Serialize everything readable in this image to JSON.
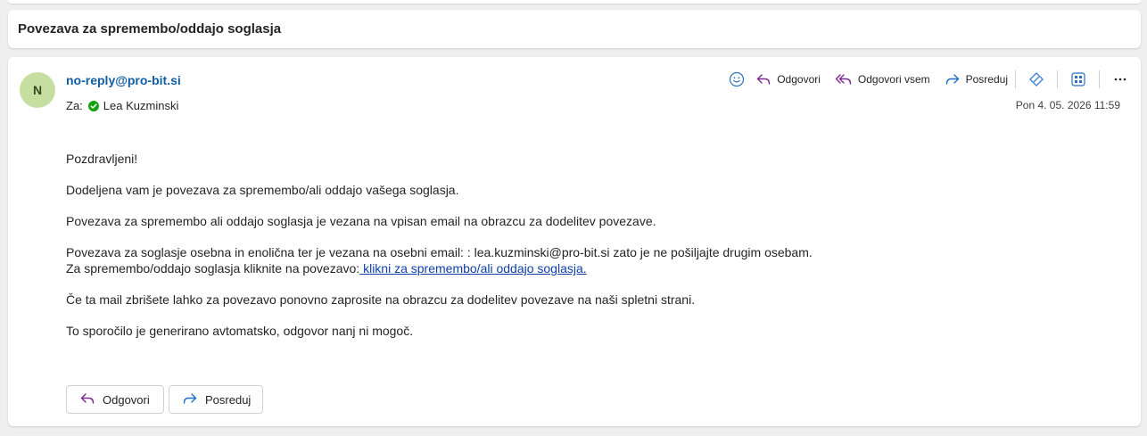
{
  "subject": "Povezava za spremembo/oddajo soglasja",
  "message": {
    "avatar_initial": "N",
    "sender": "no-reply@pro-bit.si",
    "to_label": "Za:",
    "recipient": "Lea Kuzminski",
    "timestamp": "Pon 4. 05. 2026 11:59",
    "toolbar": {
      "reply": "Odgovori",
      "reply_all": "Odgovori vsem",
      "forward": "Posreduj"
    },
    "body": {
      "greeting": "Pozdravljeni!",
      "p1": "Dodeljena vam je povezava za spremembo/ali oddajo vašega soglasja.",
      "p2": "Povezava za spremembo ali oddajo soglasja je vezana na vpisan email na obrazcu za dodelitev povezave.",
      "p3_line1": "Povezava za soglasje osebna in enolična ter je vezana na osebni email: : lea.kuzminski@pro-bit.si zato je ne pošiljajte drugim osebam.",
      "p3_line2_prefix": "Za spremembo/oddajo soglasja kliknite na povezavo:",
      "p3_link": " klikni za spremembo/ali oddajo soglasja.",
      "p4": "Če ta mail zbrišete lahko za povezavo ponovno zaprosite na obrazcu za dodelitev povezave na naši spletni strani.",
      "p5": "To sporočilo je generirano avtomatsko, odgovor nanj ni mogoč."
    },
    "actions": {
      "reply": "Odgovori",
      "forward": "Posreduj"
    }
  },
  "colors": {
    "sender_link": "#115ea3",
    "body_link": "#0f3fa8",
    "avatar_bg": "#c6dfa1",
    "reply_icon": "#7a2a8c",
    "forward_icon": "#1f6fc4",
    "presence": "#13a10e"
  },
  "icons": {
    "emoji": "emoji-icon",
    "reply": "reply-icon",
    "reply_all": "reply-all-icon",
    "forward": "forward-icon",
    "copilot": "copilot-icon",
    "apps": "apps-icon",
    "more": "more-icon",
    "presence": "presence-available-icon"
  }
}
